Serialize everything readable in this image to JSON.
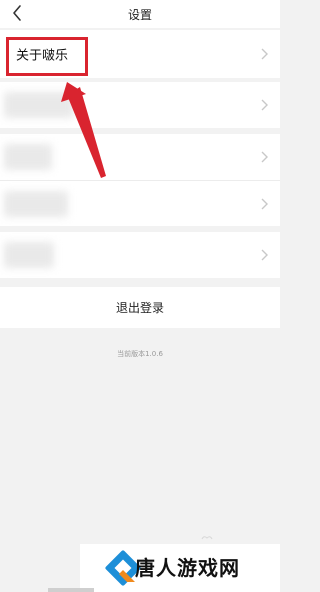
{
  "header": {
    "title": "设置"
  },
  "settings": {
    "about_label": "关于啵乐"
  },
  "logout": {
    "label": "退出登录"
  },
  "version": {
    "text": "当前版本1.0.6"
  },
  "watermark": {
    "text": "唐人游戏网"
  },
  "colors": {
    "highlight": "#d9242f",
    "logo_blue": "#1d8fd8",
    "logo_orange": "#f08a1d"
  }
}
